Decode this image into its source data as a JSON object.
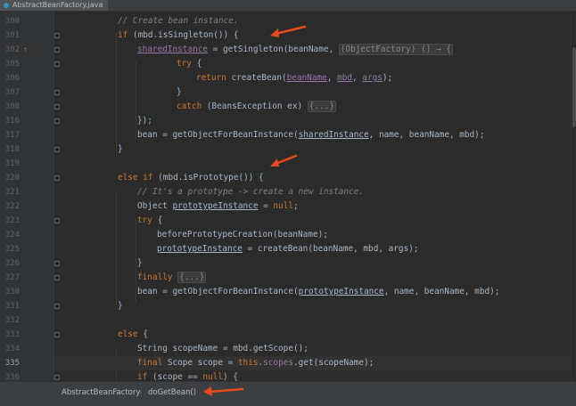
{
  "editor_tab": {
    "label": "AbstractBeanFactory.java"
  },
  "current_line": "335",
  "gutter": {
    "override_marker": "⇡"
  },
  "lines": [
    {
      "no": "300",
      "indent": 6,
      "tokens": [
        {
          "t": "// Create bean instance.",
          "c": "cm"
        }
      ]
    },
    {
      "no": "301",
      "indent": 6,
      "tokens": [
        {
          "t": "if",
          "c": "kw"
        },
        {
          "t": " (mbd.isSingleton()) {"
        }
      ]
    },
    {
      "no": "302",
      "indent": 7,
      "tokens": [
        {
          "t": "sharedInstance",
          "c": "field ul"
        },
        {
          "t": " = getSingleton(beanName, "
        },
        {
          "t": "(ObjectFactory) () → {",
          "c": "fold-text"
        }
      ]
    },
    {
      "no": "305",
      "indent": 9,
      "tokens": [
        {
          "t": "try",
          "c": "kw"
        },
        {
          "t": " {"
        }
      ]
    },
    {
      "no": "306",
      "indent": 10,
      "tokens": [
        {
          "t": "return",
          "c": "kw"
        },
        {
          "t": " createBean("
        },
        {
          "t": "beanName",
          "c": "field ul"
        },
        {
          "t": ", "
        },
        {
          "t": "mbd",
          "c": "field ul"
        },
        {
          "t": ", "
        },
        {
          "t": "args",
          "c": "field ul"
        },
        {
          "t": ");"
        }
      ]
    },
    {
      "no": "307",
      "indent": 9,
      "tokens": [
        {
          "t": "}"
        }
      ]
    },
    {
      "no": "308",
      "indent": 9,
      "tokens": [
        {
          "t": "catch",
          "c": "kw"
        },
        {
          "t": " (BeansException ex) "
        },
        {
          "t": "{...}",
          "c": "fold-text"
        }
      ]
    },
    {
      "no": "316",
      "indent": 7,
      "tokens": [
        {
          "t": "});"
        }
      ]
    },
    {
      "no": "317",
      "indent": 7,
      "tokens": [
        {
          "t": "bean = getObjectForBeanInstance("
        },
        {
          "t": "sharedInstance",
          "c": "ul"
        },
        {
          "t": ", name, beanName, mbd);"
        }
      ]
    },
    {
      "no": "318",
      "indent": 6,
      "tokens": [
        {
          "t": "}"
        }
      ]
    },
    {
      "no": "319",
      "indent": 0,
      "tokens": []
    },
    {
      "no": "320",
      "indent": 6,
      "tokens": [
        {
          "t": "else if",
          "c": "kw"
        },
        {
          "t": " (mbd.isPrototype()) {"
        }
      ]
    },
    {
      "no": "321",
      "indent": 7,
      "tokens": [
        {
          "t": "// It's a prototype -> create a new instance.",
          "c": "cm"
        }
      ]
    },
    {
      "no": "322",
      "indent": 7,
      "tokens": [
        {
          "t": "Object "
        },
        {
          "t": "prototypeInstance",
          "c": "ul"
        },
        {
          "t": " = "
        },
        {
          "t": "null",
          "c": "kw"
        },
        {
          "t": ";"
        }
      ]
    },
    {
      "no": "323",
      "indent": 7,
      "tokens": [
        {
          "t": "try",
          "c": "kw"
        },
        {
          "t": " {"
        }
      ]
    },
    {
      "no": "324",
      "indent": 8,
      "tokens": [
        {
          "t": "beforePrototypeCreation(beanName);"
        }
      ]
    },
    {
      "no": "325",
      "indent": 8,
      "tokens": [
        {
          "t": "prototypeInstance",
          "c": "ul"
        },
        {
          "t": " = createBean(beanName, mbd, args);"
        }
      ]
    },
    {
      "no": "326",
      "indent": 7,
      "tokens": [
        {
          "t": "}"
        }
      ]
    },
    {
      "no": "327",
      "indent": 7,
      "tokens": [
        {
          "t": "finally",
          "c": "kw"
        },
        {
          "t": " "
        },
        {
          "t": "{...}",
          "c": "fold-text"
        }
      ]
    },
    {
      "no": "330",
      "indent": 7,
      "tokens": [
        {
          "t": "bean = getObjectForBeanInstance("
        },
        {
          "t": "prototypeInstance",
          "c": "ul"
        },
        {
          "t": ", name, beanName, mbd);"
        }
      ]
    },
    {
      "no": "331",
      "indent": 6,
      "tokens": [
        {
          "t": "}"
        }
      ]
    },
    {
      "no": "332",
      "indent": 0,
      "tokens": []
    },
    {
      "no": "333",
      "indent": 6,
      "tokens": [
        {
          "t": "else",
          "c": "kw"
        },
        {
          "t": " {"
        }
      ]
    },
    {
      "no": "334",
      "indent": 7,
      "tokens": [
        {
          "t": "String scopeName = mbd.getScope();"
        }
      ]
    },
    {
      "no": "335",
      "indent": 7,
      "tokens": [
        {
          "t": "final",
          "c": "kw"
        },
        {
          "t": " Scope scope = "
        },
        {
          "t": "this",
          "c": "kw"
        },
        {
          "t": "."
        },
        {
          "t": "scopes",
          "c": "field"
        },
        {
          "t": ".get(scopeName);"
        }
      ]
    },
    {
      "no": "336",
      "indent": 7,
      "tokens": [
        {
          "t": "if",
          "c": "kw"
        },
        {
          "t": " (scope == "
        },
        {
          "t": "null",
          "c": "kw"
        },
        {
          "t": ") {"
        }
      ]
    }
  ],
  "breadcrumb": {
    "items": [
      "AbstractBeanFactory",
      "doGetBean()"
    ]
  },
  "colors": {
    "background": "#2b2b2b",
    "keyword": "#cc7832",
    "comment": "#808080",
    "field": "#9876aa",
    "text": "#a9b7c6",
    "annotation_arrow": "#e8491d"
  },
  "icons": [
    "java-file-icon",
    "override-marker-icon",
    "fold-marker-icon",
    "annotation-arrow-icon"
  ]
}
